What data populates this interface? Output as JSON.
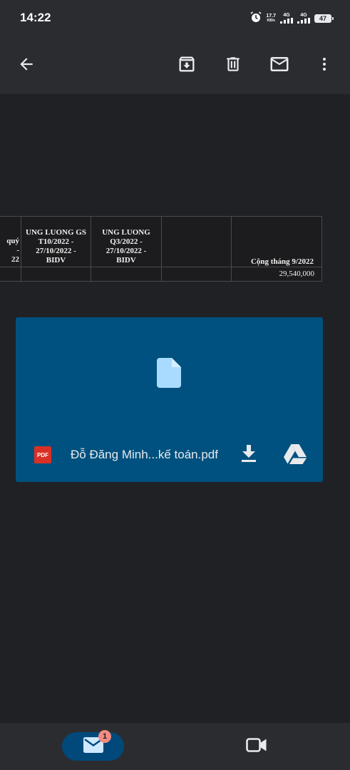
{
  "status_bar": {
    "time": "14:22",
    "net_speed_value": "17.7",
    "net_speed_unit": "KB/s",
    "signal1_label": "4G",
    "signal2_label": "4G",
    "battery": "47",
    "icons": [
      "alarm-icon",
      "signal-icon",
      "signal-icon",
      "battery-icon"
    ]
  },
  "toolbar": {
    "icons": [
      "back-arrow-icon",
      "archive-icon",
      "delete-icon",
      "mark-unread-icon",
      "more-vert-icon"
    ]
  },
  "sheet": {
    "headers": [
      "quý\n-\n22",
      "UNG LUONG GS\nT10/2022 -\n27/10/2022 -\nBIDV",
      "UNG LUONG\nQ3/2022 -\n27/10/2022 -\nBIDV",
      "",
      "Cộng tháng 9/2022"
    ],
    "row": [
      "",
      "",
      "",
      "",
      "29,540,000"
    ]
  },
  "attachment": {
    "type_label": "PDF",
    "filename": "Đỗ Đăng Minh...kế toán.pdf",
    "icons": [
      "file-icon",
      "pdf-icon",
      "download-icon",
      "drive-icon"
    ]
  },
  "bottom_nav": {
    "mail_badge_count": "1",
    "icons": [
      "mail-icon",
      "video-camera-icon"
    ]
  },
  "colors": {
    "background": "#202124",
    "bar": "#2b2c30",
    "attachment_card": "#00517f",
    "file_icon": "#a8dbff",
    "pdf_badge": "#d93025",
    "mail_pill": "#00497a",
    "badge": "#f28b82"
  }
}
